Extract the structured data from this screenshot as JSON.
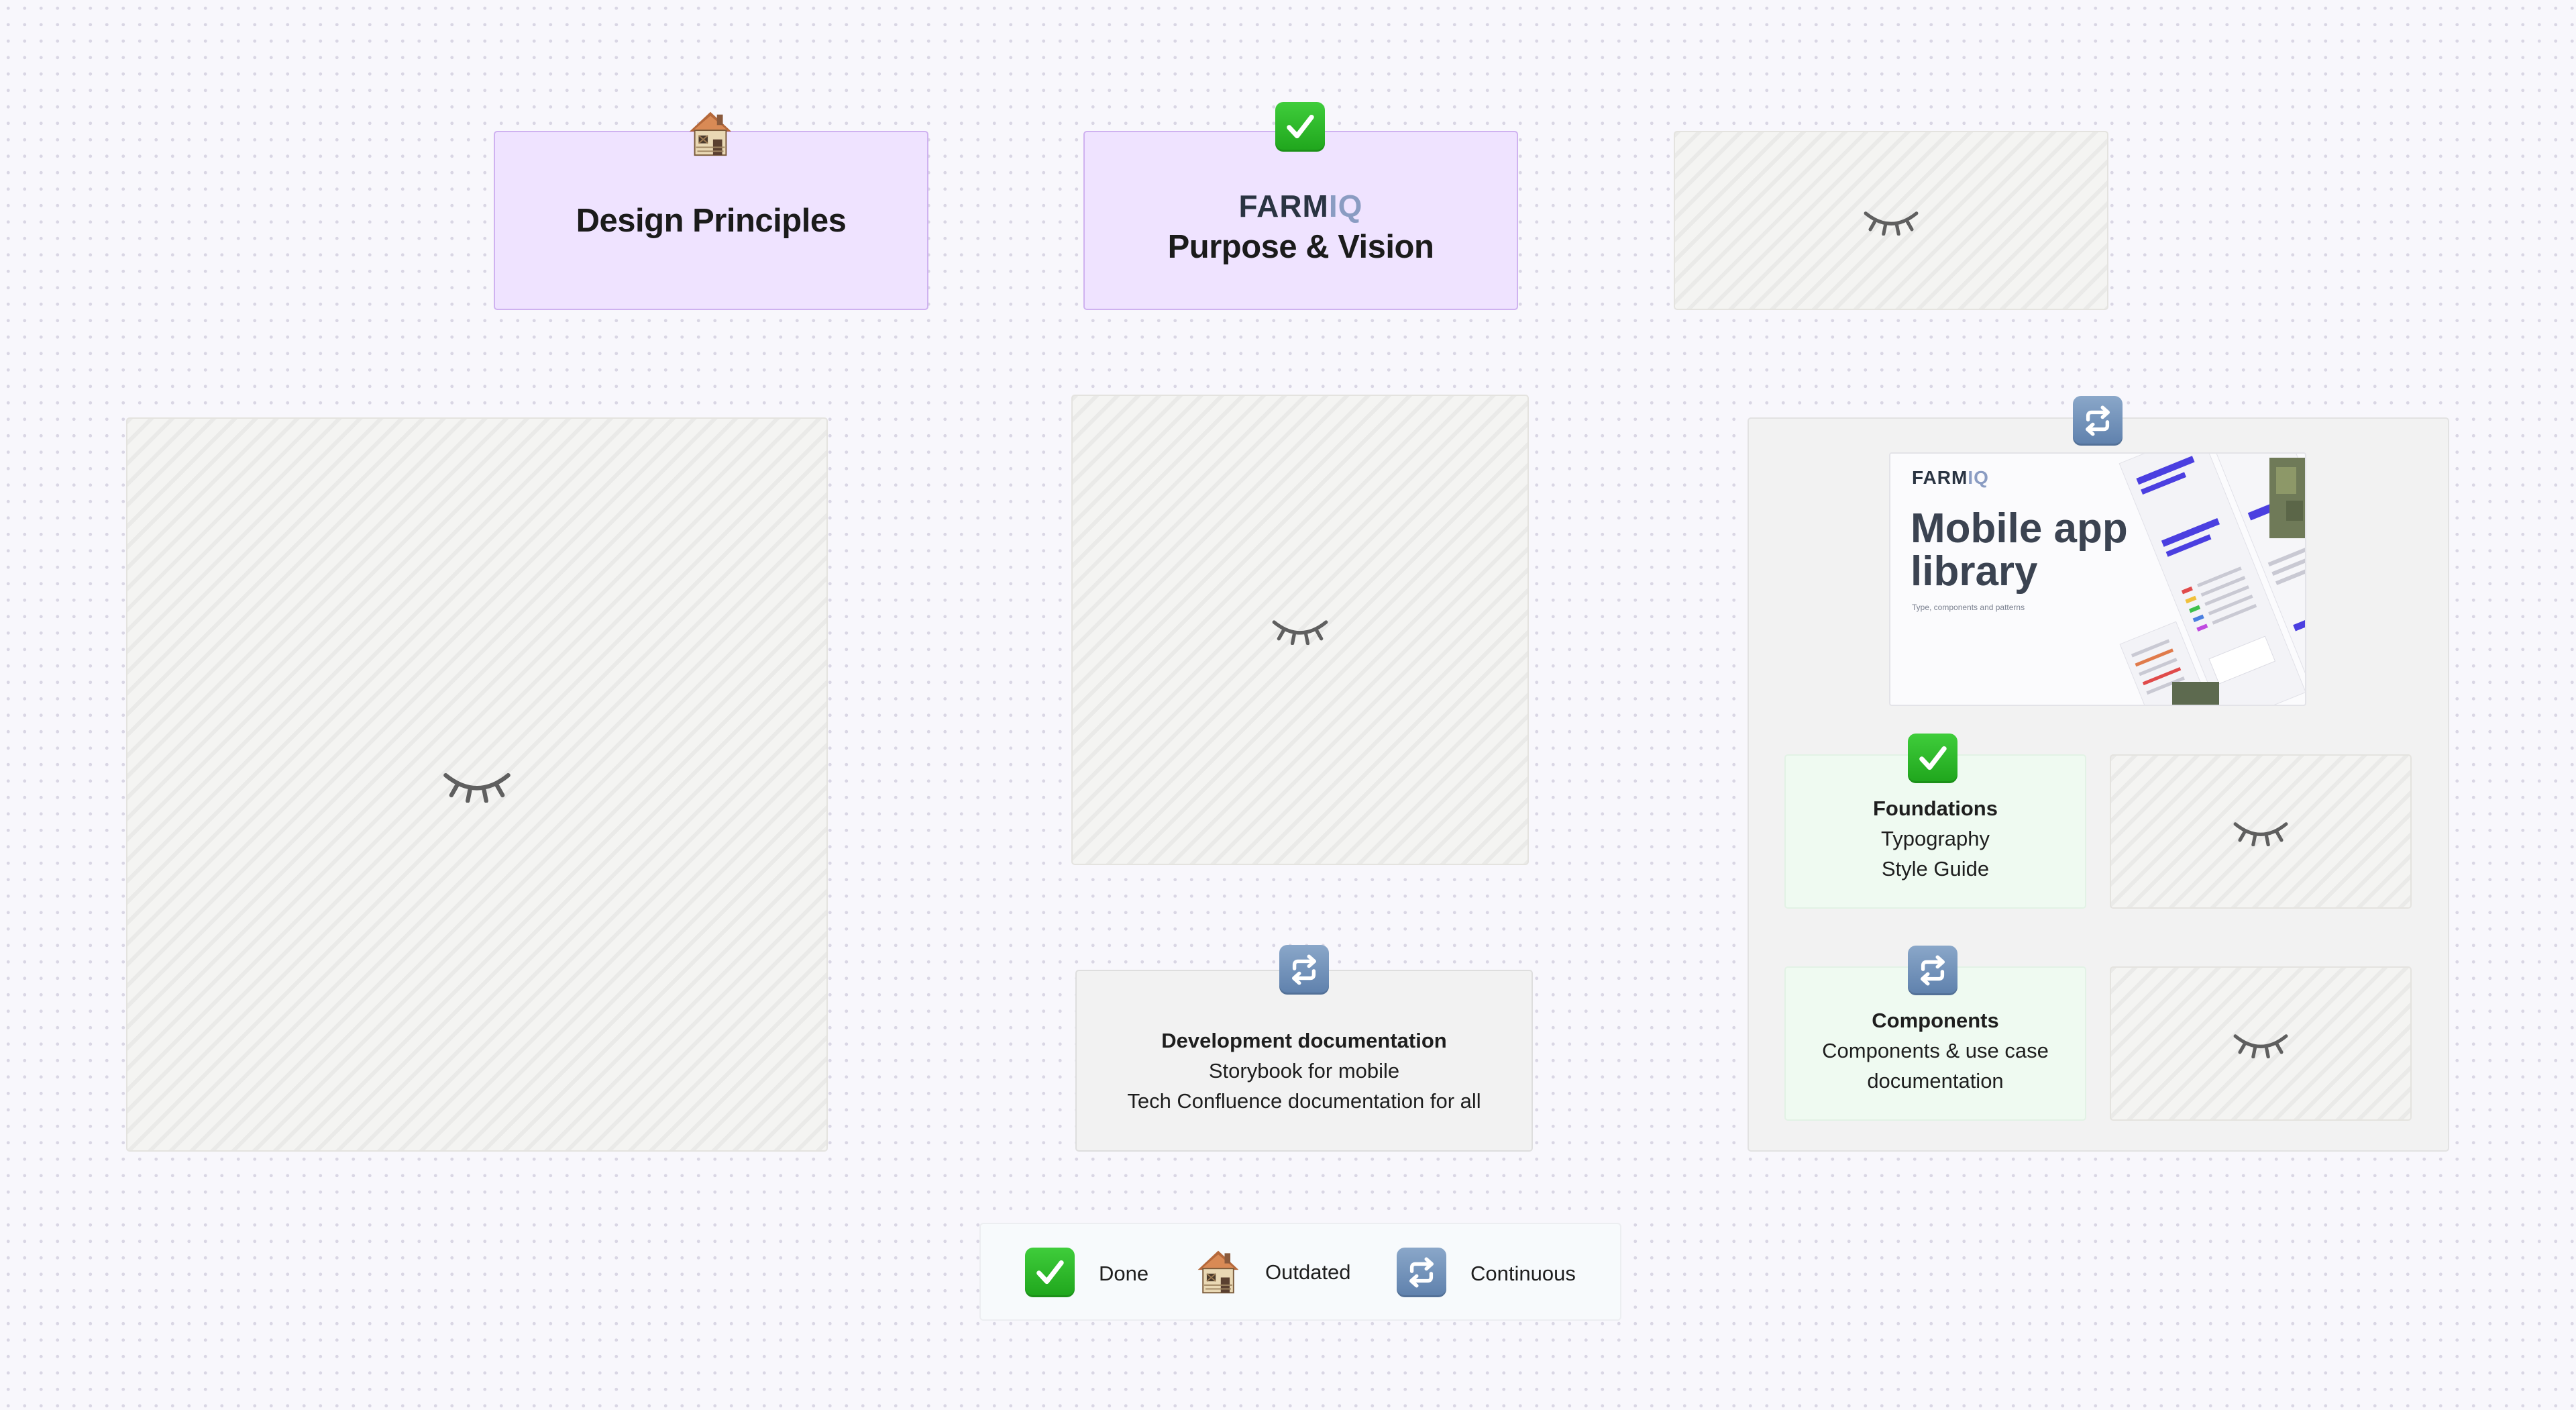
{
  "cards": {
    "design_principles": {
      "title": "Design Principles",
      "status": "outdated"
    },
    "purpose_vision": {
      "logo_main": "FARM",
      "logo_accent": "IQ",
      "title": "Purpose & Vision",
      "status": "done"
    },
    "development_docs": {
      "title": "Development documentation",
      "lines": [
        "Storybook for mobile",
        "Tech Confluence documentation for all"
      ],
      "status": "continuous"
    }
  },
  "library_panel": {
    "status": "continuous",
    "thumbnail": {
      "logo_main": "FARM",
      "logo_accent": "IQ",
      "title_line1": "Mobile app",
      "title_line2": "library",
      "subtitle": "Type, components and patterns"
    },
    "foundations": {
      "title": "Foundations",
      "lines": [
        "Typography",
        "Style Guide"
      ],
      "status": "done"
    },
    "components": {
      "title": "Components",
      "lines": [
        "Components & use case",
        "documentation"
      ],
      "status": "continuous"
    }
  },
  "legend": {
    "items": [
      {
        "icon": "check-mark-icon",
        "label": "Done"
      },
      {
        "icon": "derelict-house-icon",
        "label": "Outdated"
      },
      {
        "icon": "repeat-icon",
        "label": "Continuous"
      }
    ]
  },
  "icons": {
    "hidden": "closed-eye-icon",
    "done": "check-mark-icon",
    "outdated": "derelict-house-icon",
    "continuous": "repeat-icon"
  },
  "colors": {
    "purple_card": "#efe3ff",
    "green_card": "#effaf1",
    "gray_panel": "#f2f2f2",
    "done_green": "#2bb628",
    "continuous_blue": "#6f8db7"
  }
}
